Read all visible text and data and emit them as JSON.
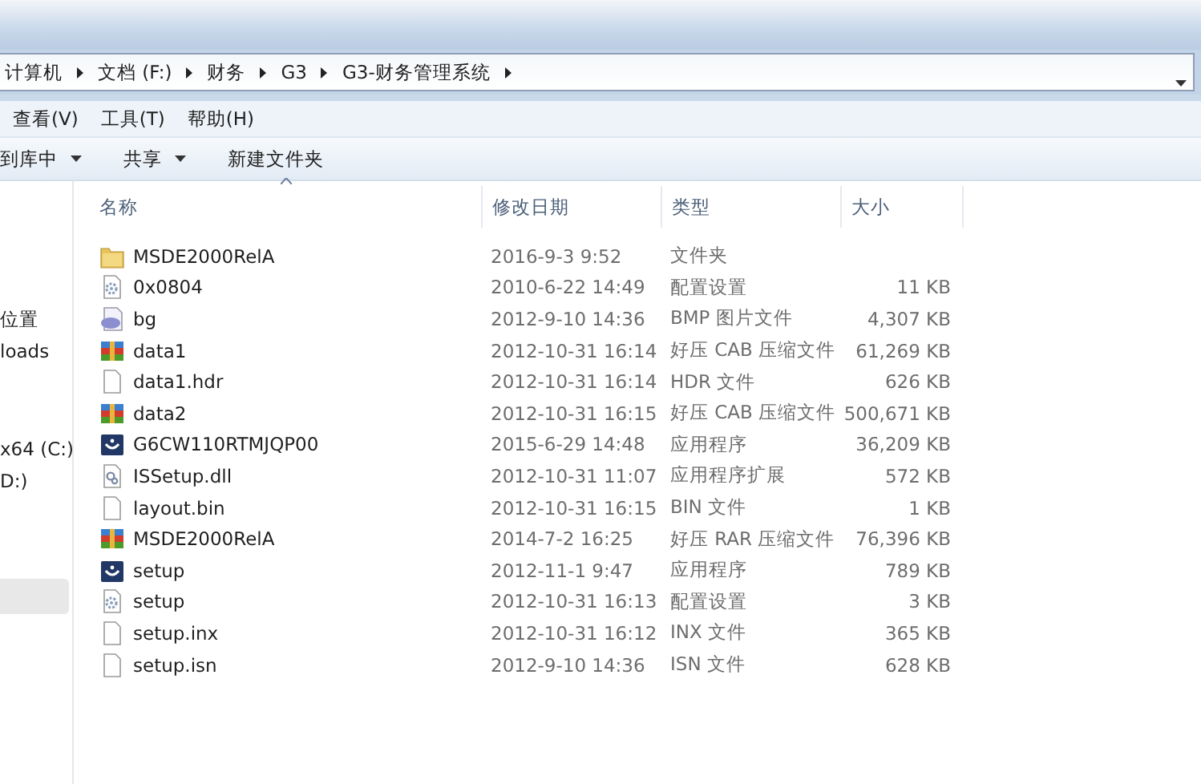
{
  "address_bar": {
    "crumbs": [
      "计算机",
      "文档 (F:)",
      "财务",
      "G3",
      "G3-财务管理系统"
    ]
  },
  "menu": [
    "查看(V)",
    "工具(T)",
    "帮助(H)"
  ],
  "toolbar": [
    {
      "label": "到库中",
      "dropdown": true
    },
    {
      "label": "共享",
      "dropdown": true
    },
    {
      "label": "新建文件夹",
      "dropdown": false
    }
  ],
  "nav_pane": [
    {
      "label": "位置",
      "selected": false
    },
    {
      "label": "loads",
      "selected": false
    },
    {
      "label": "x64 (C:)",
      "selected": false
    },
    {
      "label": "D:)",
      "selected": false
    },
    {
      "selected": true
    }
  ],
  "columns": [
    "名称",
    "修改日期",
    "类型",
    "大小"
  ],
  "files": [
    {
      "name": "MSDE2000RelA",
      "kind": "folder",
      "date": "2016-9-3 9:52",
      "type": "文件夹"
    },
    {
      "name": "0x0804",
      "kind": "config",
      "date": "2010-6-22 14:49",
      "type": "配置设置",
      "size": "11 KB"
    },
    {
      "name": "bg",
      "kind": "bmp",
      "date": "2012-9-10 14:36",
      "type": "BMP 图片文件",
      "size": "4,307 KB"
    },
    {
      "name": "data1",
      "kind": "archive",
      "date": "2012-10-31 16:14",
      "type": "好压 CAB 压缩文件",
      "size": "61,269 KB"
    },
    {
      "name": "data1.hdr",
      "kind": "file",
      "date": "2012-10-31 16:14",
      "type": "HDR 文件",
      "size": "626 KB"
    },
    {
      "name": "data2",
      "kind": "archive",
      "date": "2012-10-31 16:15",
      "type": "好压 CAB 压缩文件",
      "size": "500,671 KB"
    },
    {
      "name": "G6CW110RTMJQP00",
      "kind": "app",
      "date": "2015-6-29 14:48",
      "type": "应用程序",
      "size": "36,209 KB"
    },
    {
      "name": "ISSetup.dll",
      "kind": "dll",
      "date": "2012-10-31 11:07",
      "type": "应用程序扩展",
      "size": "572 KB"
    },
    {
      "name": "layout.bin",
      "kind": "file",
      "date": "2012-10-31 16:15",
      "type": "BIN 文件",
      "size": "1 KB"
    },
    {
      "name": "MSDE2000RelA",
      "kind": "archive",
      "date": "2014-7-2 16:25",
      "type": "好压 RAR 压缩文件",
      "size": "76,396 KB"
    },
    {
      "name": "setup",
      "kind": "app",
      "date": "2012-11-1 9:47",
      "type": "应用程序",
      "size": "789 KB"
    },
    {
      "name": "setup",
      "kind": "config",
      "date": "2012-10-31 16:13",
      "type": "配置设置",
      "size": "3 KB"
    },
    {
      "name": "setup.inx",
      "kind": "file",
      "date": "2012-10-31 16:12",
      "type": "INX 文件",
      "size": "365 KB"
    },
    {
      "name": "setup.isn",
      "kind": "file",
      "date": "2012-9-10 14:36",
      "type": "ISN 文件",
      "size": "628 KB"
    }
  ]
}
